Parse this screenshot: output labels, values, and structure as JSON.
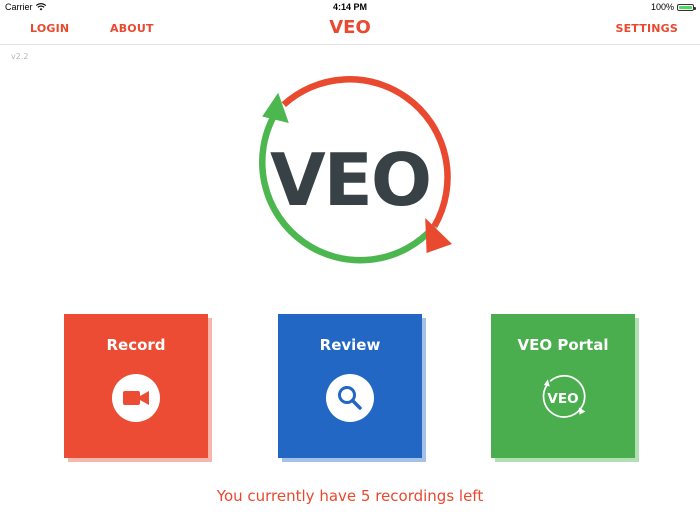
{
  "status_bar": {
    "carrier": "Carrier",
    "time": "4:14 PM",
    "battery_percent": "100%",
    "battery_level": 1.0
  },
  "nav": {
    "login_label": "LOGIN",
    "about_label": "ABOUT",
    "title": "VEO",
    "settings_label": "SETTINGS"
  },
  "version": "v2.2",
  "logo": {
    "text": "VEO",
    "colors": {
      "green": "#4cb64f",
      "red": "#e9492f",
      "text": "#384146"
    }
  },
  "tiles": [
    {
      "label": "Record",
      "icon": "video-camera-icon",
      "color": "#ec4b34"
    },
    {
      "label": "Review",
      "icon": "magnifier-icon",
      "color": "#2367c4"
    },
    {
      "label": "VEO Portal",
      "icon": "veo-logo-icon",
      "icon_text": "VEO",
      "color": "#4aae4f"
    }
  ],
  "footer": {
    "recordings_text": "You currently have 5 recordings left"
  },
  "accent_color": "#e9492f"
}
